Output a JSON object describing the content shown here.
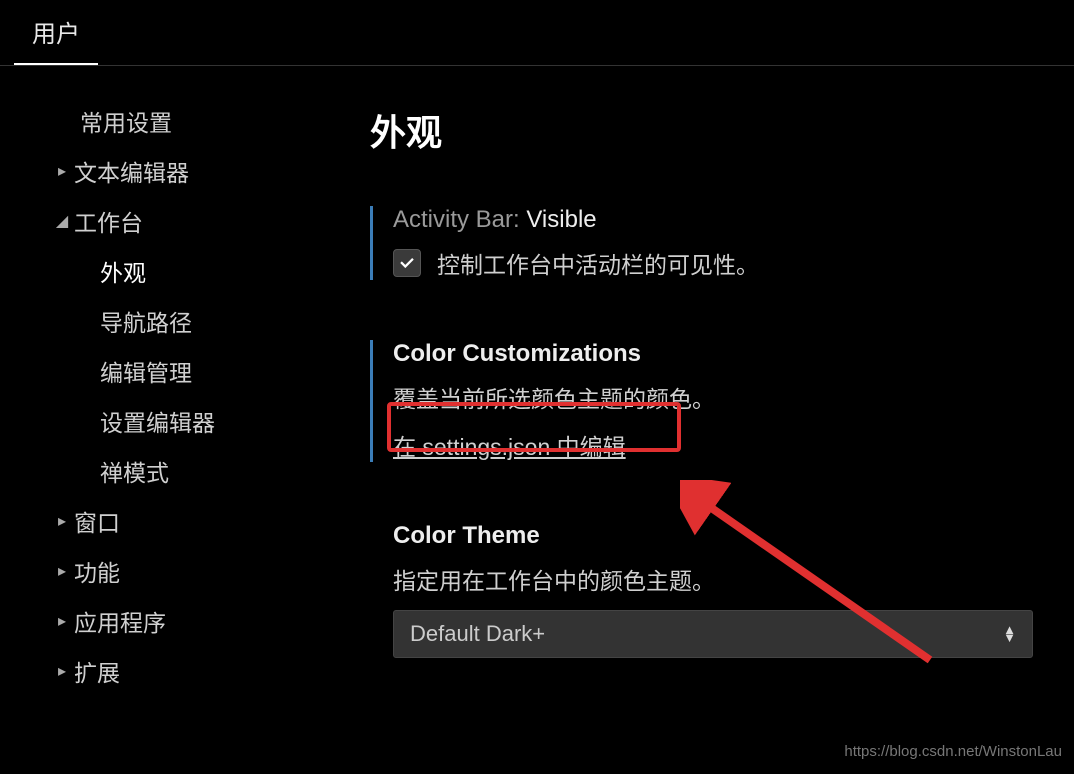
{
  "tabs": {
    "user": "用户"
  },
  "sidebar": {
    "items": [
      {
        "label": "常用设置",
        "twisty": "",
        "indent": 0
      },
      {
        "label": "文本编辑器",
        "twisty": "▸",
        "indent": 0
      },
      {
        "label": "工作台",
        "twisty": "◢",
        "indent": 0
      },
      {
        "label": "外观",
        "twisty": "",
        "indent": 1,
        "active": true
      },
      {
        "label": "导航路径",
        "twisty": "",
        "indent": 1
      },
      {
        "label": "编辑管理",
        "twisty": "",
        "indent": 1
      },
      {
        "label": "设置编辑器",
        "twisty": "",
        "indent": 1
      },
      {
        "label": "禅模式",
        "twisty": "",
        "indent": 1
      },
      {
        "label": "窗口",
        "twisty": "▸",
        "indent": 0
      },
      {
        "label": "功能",
        "twisty": "▸",
        "indent": 0
      },
      {
        "label": "应用程序",
        "twisty": "▸",
        "indent": 0
      },
      {
        "label": "扩展",
        "twisty": "▸",
        "indent": 0
      }
    ]
  },
  "content": {
    "title": "外观",
    "activity_bar": {
      "prefix": "Activity Bar: ",
      "name": "Visible",
      "desc": "控制工作台中活动栏的可见性。",
      "checked": true
    },
    "color_customizations": {
      "name": "Color Customizations",
      "desc": "覆盖当前所选颜色主题的颜色。",
      "link": "在 settings.json 中编辑"
    },
    "color_theme": {
      "name": "Color Theme",
      "desc": "指定用在工作台中的颜色主题。",
      "value": "Default Dark+"
    }
  },
  "watermark": "https://blog.csdn.net/WinstonLau"
}
